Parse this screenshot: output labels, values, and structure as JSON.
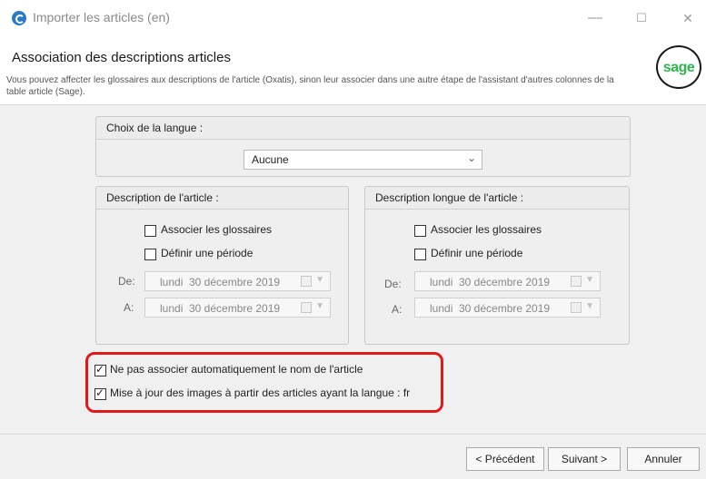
{
  "window": {
    "title": "Importer les articles (en)",
    "minimize_glyph": "—",
    "maximize_glyph": "☐",
    "close_glyph": "✕"
  },
  "header": {
    "title": "Association des descriptions articles",
    "description": "Vous pouvez affecter les glossaires aux descriptions de l'article (Oxatis), sinon leur associer dans une autre étape de l'assistant d'autres colonnes de la table article (Sage).",
    "logo_text": "sage",
    "logo_color": "#2fb64e"
  },
  "language": {
    "group_title": "Choix de la langue :",
    "selected": "Aucune"
  },
  "description": {
    "group_title": "Description de l'article :",
    "assoc_label": "Associer les glossaires",
    "assoc_checked": false,
    "period_label": "Définir une période",
    "period_checked": false,
    "from_label": "De:",
    "from_day": "lundi",
    "from_date": "30 décembre 2019",
    "to_label": "A:",
    "to_day": "lundi",
    "to_date": "30 décembre 2019"
  },
  "long_description": {
    "group_title": "Description longue de l'article :",
    "assoc_label": "Associer les glossaires",
    "assoc_checked": false,
    "period_label": "Définir une période",
    "period_checked": false,
    "from_label": "De:",
    "from_day": "lundi",
    "from_date": "30 décembre 2019",
    "to_label": "A:",
    "to_day": "lundi",
    "to_date": "30 décembre 2019"
  },
  "options": {
    "no_auto_name_label": "Ne pas associer automatiquement le nom de l'article",
    "no_auto_name_checked": true,
    "update_images_label": "Mise à jour des images à partir des articles ayant la langue : fr",
    "update_images_checked": true,
    "highlight_color": "#e0191b"
  },
  "footer": {
    "prev_label": "< Précédent",
    "next_label": "Suivant >",
    "cancel_label": "Annuler"
  }
}
